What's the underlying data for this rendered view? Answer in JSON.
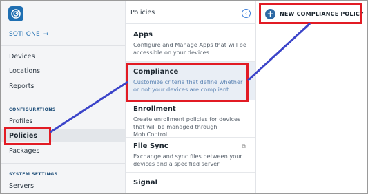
{
  "app": {
    "org_label": "SOTI ONE",
    "org_arrow": "→"
  },
  "sidebar": {
    "items_top": [
      "Devices",
      "Locations",
      "Reports"
    ],
    "section_configurations": "CONFIGURATIONS",
    "items_config": [
      "Profiles",
      "Policies",
      "Packages"
    ],
    "active_item": "Policies",
    "section_system": "SYSTEM SETTINGS",
    "items_system": [
      "Servers"
    ]
  },
  "panel": {
    "title": "Policies",
    "collapse_icon": "‹",
    "cards": [
      {
        "title": "Apps",
        "desc": "Configure and Manage Apps that will be accessible on your devices"
      },
      {
        "title": "Compliance",
        "desc": "Customize criteria that define whether or not your devices are compliant"
      },
      {
        "title": "Enrollment",
        "desc": "Create enrollment policies for devices that will be managed through MobiControl"
      },
      {
        "title": "File Sync",
        "desc": "Exchange and sync files between your devices and a specified server",
        "external_icon": "⧉"
      },
      {
        "title": "Signal",
        "desc": ""
      }
    ]
  },
  "toolbar": {
    "new_policy_label": "NEW COMPLIANCE POLICY",
    "plus_icon": "+"
  },
  "colors": {
    "accent": "#1f6fb2",
    "highlight": "#e21b24",
    "arrow": "#3b44c9"
  }
}
